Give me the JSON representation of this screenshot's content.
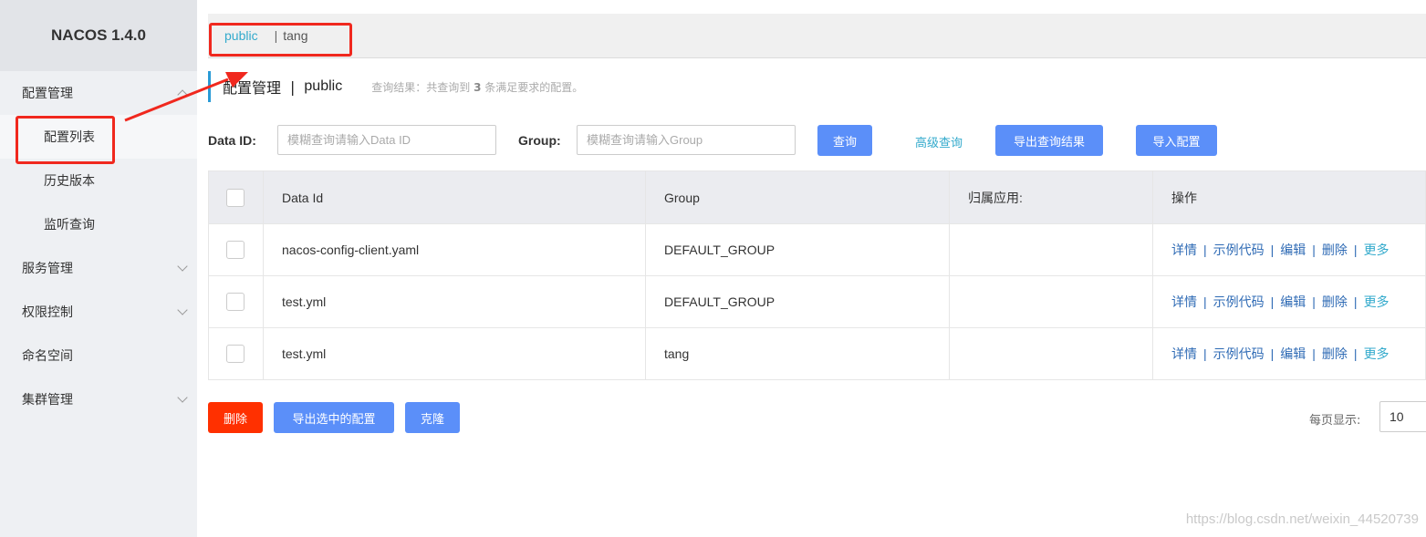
{
  "sidebar": {
    "brand": "NACOS 1.4.0",
    "items": [
      {
        "label": "配置管理"
      },
      {
        "label": "配置列表"
      },
      {
        "label": "历史版本"
      },
      {
        "label": "监听查询"
      },
      {
        "label": "服务管理"
      },
      {
        "label": "权限控制"
      },
      {
        "label": "命名空间"
      },
      {
        "label": "集群管理"
      }
    ]
  },
  "namespace_bar": {
    "active": "public",
    "separator": "|",
    "other": "tang"
  },
  "header": {
    "title": "配置管理",
    "separator": "|",
    "namespace": "public",
    "result_prefix": "查询结果：共查询到",
    "result_count": "3",
    "result_suffix": "条满足要求的配置。"
  },
  "filters": {
    "data_id_label": "Data ID:",
    "data_id_placeholder": "模糊查询请输入Data ID",
    "data_id_value": "",
    "group_label": "Group:",
    "group_placeholder": "模糊查询请输入Group",
    "group_value": "",
    "query_button": "查询",
    "advanced_link": "高级查询",
    "export_results_button": "导出查询结果",
    "import_button": "导入配置"
  },
  "table": {
    "columns": [
      "Data Id",
      "Group",
      "归属应用:",
      "操作"
    ],
    "rows": [
      {
        "data_id": "nacos-config-client.yaml",
        "group": "DEFAULT_GROUP",
        "app": ""
      },
      {
        "data_id": "test.yml",
        "group": "DEFAULT_GROUP",
        "app": ""
      },
      {
        "data_id": "test.yml",
        "group": "tang",
        "app": ""
      }
    ],
    "actions": {
      "detail": "详情",
      "sample_code": "示例代码",
      "edit": "编辑",
      "delete": "删除",
      "more": "更多",
      "separator": "|"
    }
  },
  "footer": {
    "delete_button": "删除",
    "export_selected_button": "导出选中的配置",
    "clone_button": "克隆",
    "page_size_label": "每页显示:",
    "page_size_value": "10"
  },
  "watermark": "https://blog.csdn.net/weixin_44520739",
  "colors": {
    "accent": "#2a9bd6",
    "primary_button": "#5b8ff9",
    "danger_button": "#ff3000",
    "link": "#2f6bb5",
    "annotation": "#f0281e"
  }
}
